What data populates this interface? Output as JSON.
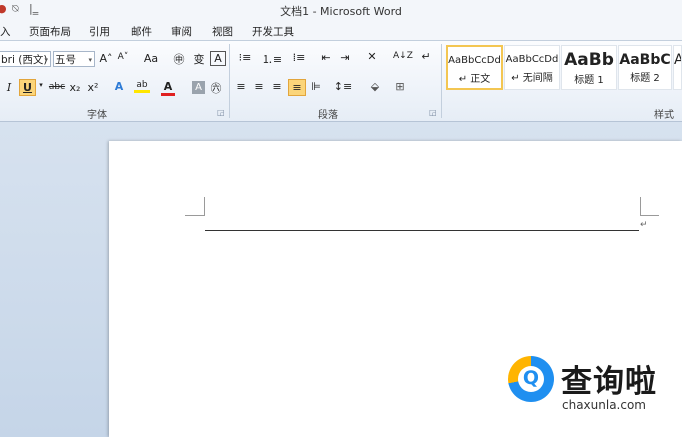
{
  "window": {
    "title": "文档1 - Microsoft Word",
    "qat_undo": "⍉",
    "qat_more": "|‗"
  },
  "tabs": [
    "入",
    "页面布局",
    "引用",
    "邮件",
    "审阅",
    "视图",
    "开发工具"
  ],
  "ribbon": {
    "font_name": "bri (西文)",
    "font_size": "五号",
    "grow_font": "A˄",
    "shrink_font": "A˅",
    "change_case": "Aa",
    "phonetic": "㊥",
    "char_border": "A",
    "italic": "I",
    "underline": "U",
    "strike": "abc",
    "subscript": "x₂",
    "superscript": "x²",
    "text_effect": "A",
    "highlight": "ab",
    "font_color": "A",
    "char_shading": "A",
    "enclose": "㊅",
    "sort": "A↓Z",
    "show_marks": "↵",
    "groups": {
      "font": "字体",
      "paragraph": "段落",
      "styles": "样式"
    },
    "styles": [
      {
        "sample": "AaBbCcDd",
        "label": "↵ 正文"
      },
      {
        "sample": "AaBbCcDd",
        "label": "↵ 无间隔"
      },
      {
        "sample": "AaBb",
        "label": "标题 1"
      },
      {
        "sample": "AaBbC",
        "label": "标题 2"
      },
      {
        "sample": "A",
        "label": ""
      }
    ]
  },
  "document": {
    "para_mark": "↵"
  },
  "watermark": {
    "name": "查询啦",
    "url": "chaxunla.com",
    "q": "Q"
  },
  "colors": {
    "accent_blue": "#1f8ff0",
    "accent_yellow": "#ffb400",
    "selected_style": "#f3c652"
  }
}
